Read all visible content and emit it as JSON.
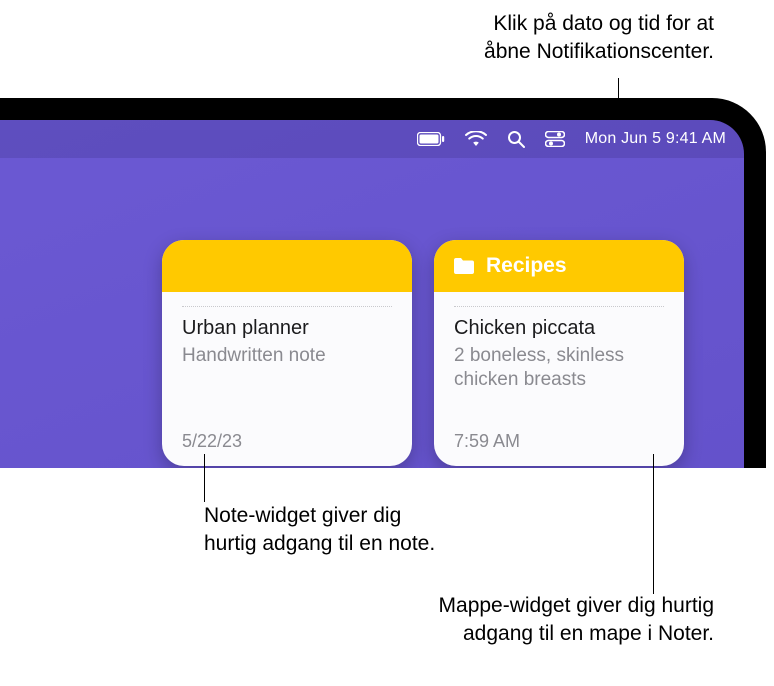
{
  "callouts": {
    "top": "Klik på dato og tid for at\nåbne Notifikationscenter.",
    "left": "Note-widget giver dig\nhurtig adgang til en note.",
    "right": "Mappe-widget giver dig hurtig\nadgang til en mape i Noter."
  },
  "menubar": {
    "clock": "Mon Jun 5  9:41 AM"
  },
  "widgets": {
    "note": {
      "title": "Urban planner",
      "subtitle": "Handwritten note",
      "timestamp": "5/22/23"
    },
    "folder": {
      "folder_label": "Recipes",
      "title": "Chicken piccata",
      "subtitle": "2 boneless, skinless\nchicken breasts",
      "timestamp": "7:59 AM"
    }
  }
}
